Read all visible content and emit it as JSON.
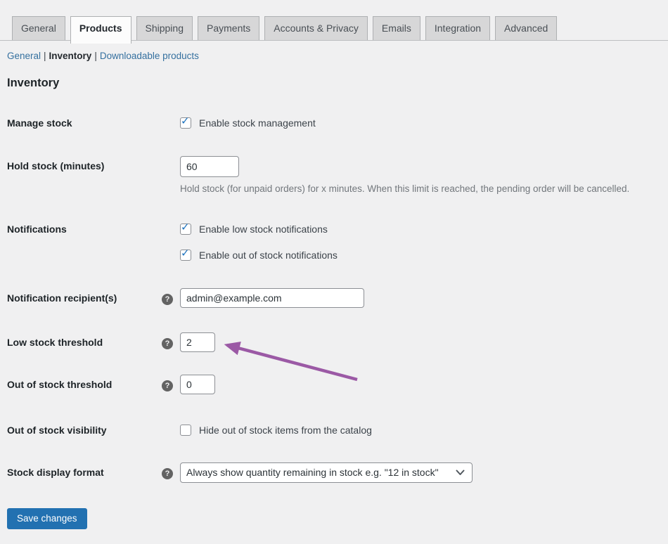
{
  "tabs": [
    {
      "label": "General"
    },
    {
      "label": "Products"
    },
    {
      "label": "Shipping"
    },
    {
      "label": "Payments"
    },
    {
      "label": "Accounts & Privacy"
    },
    {
      "label": "Emails"
    },
    {
      "label": "Integration"
    },
    {
      "label": "Advanced"
    }
  ],
  "active_tab": "Products",
  "subnav": {
    "separator": "|",
    "items": [
      {
        "label": "General",
        "current": false
      },
      {
        "label": "Inventory",
        "current": true
      },
      {
        "label": "Downloadable products",
        "current": false
      }
    ]
  },
  "section": {
    "title": "Inventory"
  },
  "icons": {
    "help_glyph": "?"
  },
  "form": {
    "rows": [
      {
        "label": "Manage stock",
        "checkboxes": [
          {
            "text": "Enable stock management",
            "check": "✓"
          }
        ]
      },
      {
        "label": "Hold stock (minutes)",
        "value": "60",
        "description": "Hold stock (for unpaid orders) for x minutes. When this limit is reached, the pending order will be cancelled."
      },
      {
        "label": "Notifications",
        "checkboxes": [
          {
            "text": "Enable low stock notifications",
            "check": "✓"
          },
          {
            "text": "Enable out of stock notifications",
            "check": "✓"
          }
        ]
      },
      {
        "label": "Notification recipient(s)",
        "value": "admin@example.com"
      },
      {
        "label": "Low stock threshold",
        "value": "2"
      },
      {
        "label": "Out of stock threshold",
        "value": "0"
      },
      {
        "label": "Out of stock visibility",
        "checkboxes": [
          {
            "text": "Hide out of stock items from the catalog",
            "check": ""
          }
        ]
      },
      {
        "label": "Stock display format",
        "select_value": "Always show quantity remaining in stock e.g. \"12 in stock\""
      }
    ]
  },
  "save_button": {
    "label": "Save changes"
  },
  "annotation": {
    "arrow_color": "#9b59a5"
  },
  "colors": {
    "page_background": "#f0f0f1",
    "accent_blue": "#2271b1",
    "check_blue": "#1e73be",
    "link_blue": "#35709f"
  }
}
